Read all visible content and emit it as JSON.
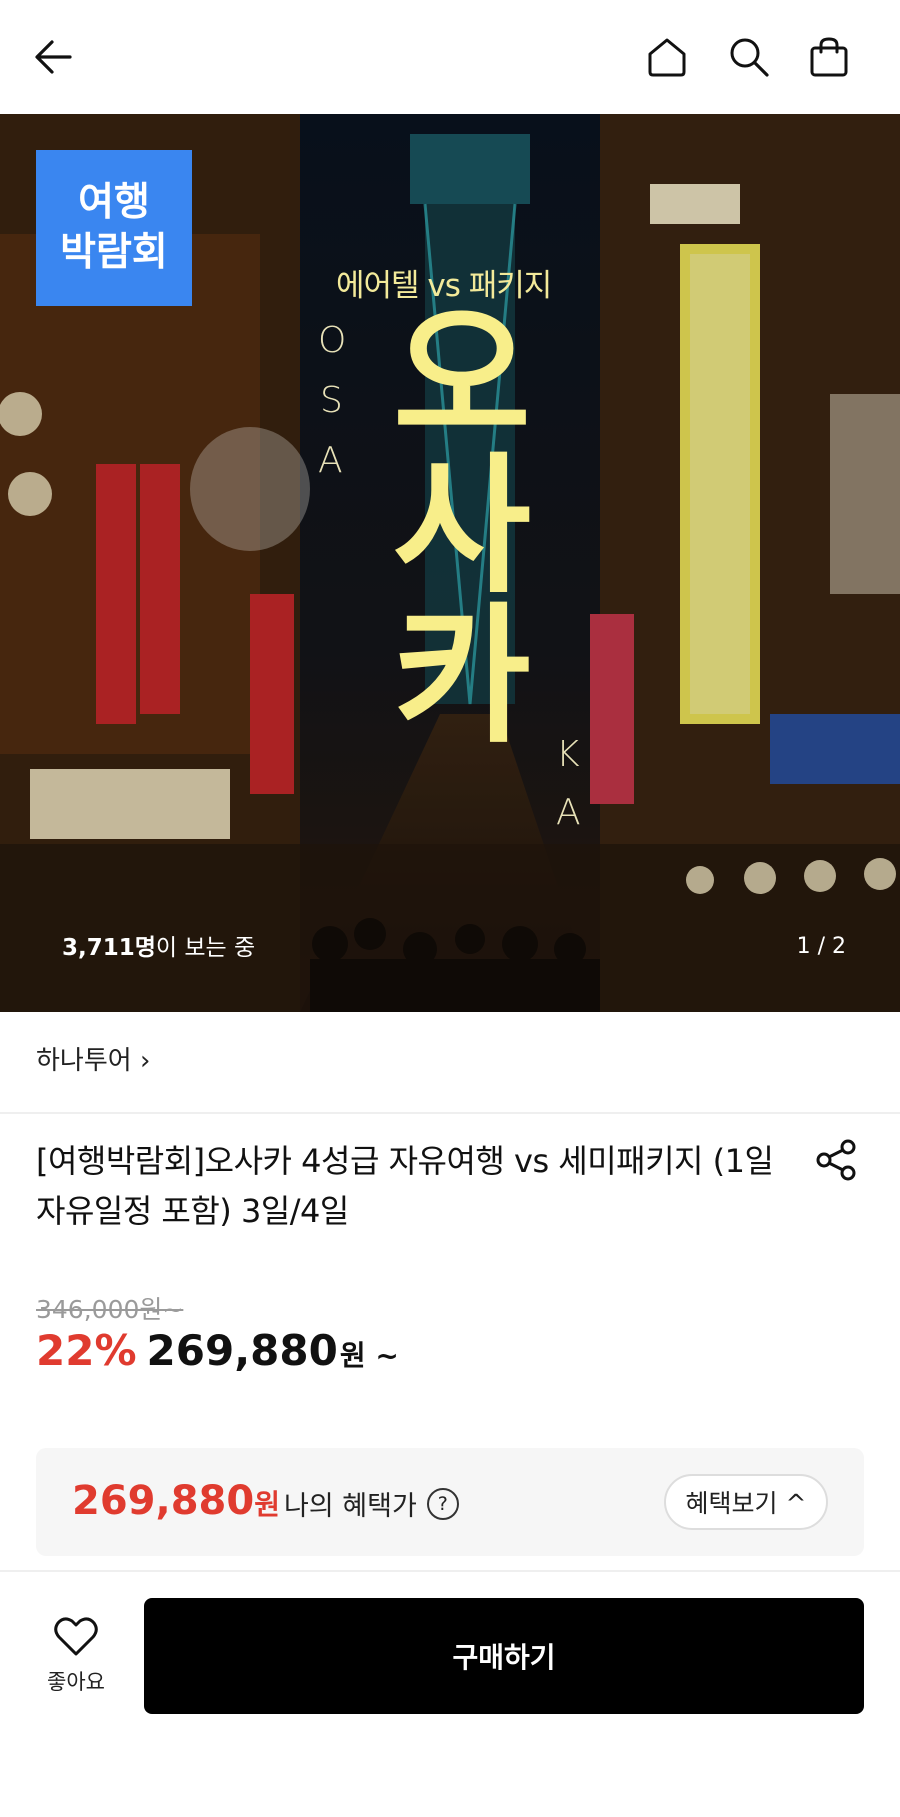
{
  "header": {
    "back_icon": "arrow-left-icon",
    "home_icon": "home-icon",
    "search_icon": "search-icon",
    "cart_icon": "shopping-bag-icon"
  },
  "hero": {
    "badge_line1": "여행",
    "badge_line2": "박람회",
    "subtitle": "에어텔 vs 패키지",
    "title_chars": [
      "오",
      "사",
      "카"
    ],
    "latin_left": [
      "O",
      "S",
      "A"
    ],
    "latin_right": [
      "K",
      "A"
    ],
    "viewers_count": "3,711명",
    "viewers_suffix": "이 보는 중",
    "pager": "1 / 2"
  },
  "seller": {
    "name": "하나투어",
    "chevron": "›"
  },
  "product": {
    "title": "[여행박람회]오사카 4성급 자유여행 vs 세미패키지 (1일 자유일정 포함) 3일/4일",
    "share_icon": "share-icon"
  },
  "price": {
    "original": "346,000원~",
    "discount": "22%",
    "current": "269,880",
    "current_unit": "원 ~"
  },
  "benefit": {
    "price": "269,880",
    "unit": "원",
    "label": "나의 혜택가",
    "help": "?",
    "button": "혜택보기 ^"
  },
  "bottom": {
    "like_label": "좋아요",
    "like_icon": "heart-icon",
    "buy_label": "구매하기"
  },
  "colors": {
    "accent_red": "#e03b2f",
    "badge_blue": "#3a86f0",
    "hero_yellow": "#f8ee8a",
    "buy_button": "#000000"
  }
}
